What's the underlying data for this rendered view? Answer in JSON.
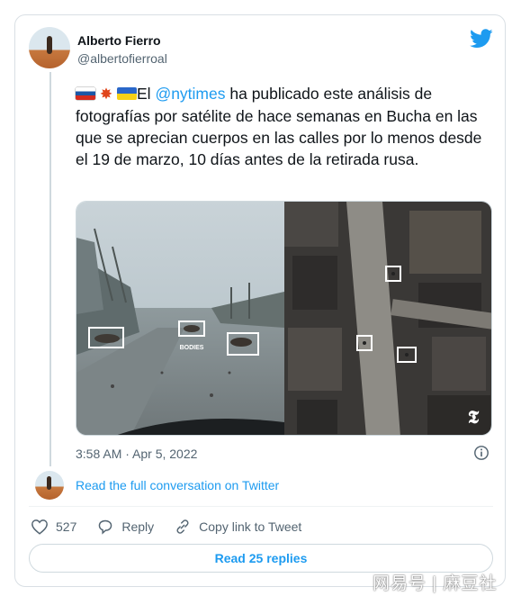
{
  "author": {
    "display_name": "Alberto Fierro",
    "handle": "@albertofierroal"
  },
  "tweet": {
    "emoji_prefix": [
      "russia-flag-icon",
      "collision-icon",
      "ukraine-flag-icon"
    ],
    "text_before_mention": "El ",
    "mention": "@nytimes",
    "text_after_mention": " ha publicado este análisis de fotografías por satélite de hace semanas en Bucha en las que se aprecian cuerpos en las calles por lo menos desde el 19 de marzo, 10 días antes de la retirada rusa.",
    "timestamp": "3:58 AM · Apr 5, 2022"
  },
  "media": {
    "overlay_label": "BODIES",
    "publisher_logo": "new-york-times-logo"
  },
  "conversation_link": "Read the full conversation on Twitter",
  "actions": {
    "likes_count": "527",
    "reply_label": "Reply",
    "copy_link_label": "Copy link to Tweet"
  },
  "read_replies_label": "Read 25 replies",
  "watermark": "网易号 | 麻豆社",
  "colors": {
    "accent": "#1d9bf0",
    "text": "#0f1419",
    "secondary_text": "#536471",
    "border": "#cfd9de"
  }
}
